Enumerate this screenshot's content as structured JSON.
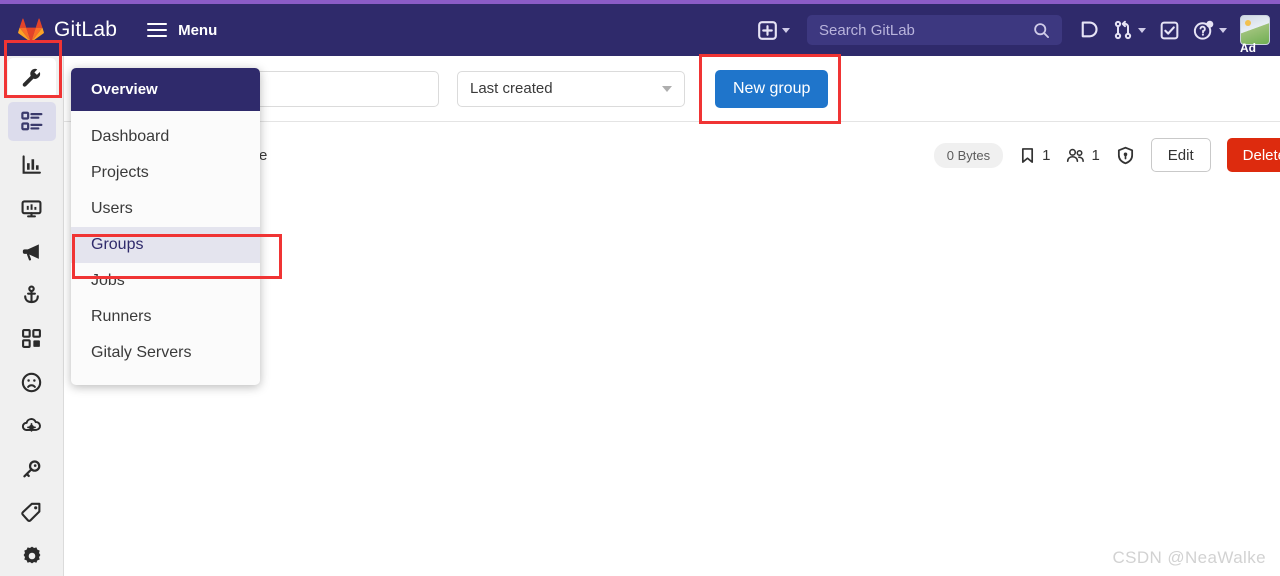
{
  "header": {
    "brand": "GitLab",
    "menu_label": "Menu",
    "logo_icon": "gitlab-tanuki-logo",
    "hamburger_icon": "hamburger-icon",
    "plus_icon": "plus-square-icon",
    "search": {
      "placeholder": "Search GitLab",
      "value": "",
      "icon": "search-icon"
    },
    "issues_icon": "issues-icon",
    "merge_requests_icon": "merge-request-icon",
    "todos_icon": "todo-check-icon",
    "help_icon": "help-question-icon",
    "avatar": {
      "name": "Ad",
      "icon": "user-avatar"
    }
  },
  "rail": {
    "items": [
      {
        "name": "admin-wrench",
        "icon": "wrench-icon",
        "state": "first"
      },
      {
        "name": "overview",
        "icon": "list-details-icon",
        "state": "active"
      },
      {
        "name": "analytics",
        "icon": "chart-bar-icon",
        "state": ""
      },
      {
        "name": "monitoring",
        "icon": "monitor-icon",
        "state": ""
      },
      {
        "name": "messages",
        "icon": "megaphone-icon",
        "state": ""
      },
      {
        "name": "deploy-keys",
        "icon": "anchor-icon",
        "state": ""
      },
      {
        "name": "applications",
        "icon": "apps-grid-icon",
        "state": ""
      },
      {
        "name": "abuse-reports",
        "icon": "sad-face-icon",
        "state": ""
      },
      {
        "name": "kubernetes",
        "icon": "cloud-gear-icon",
        "state": ""
      },
      {
        "name": "credentials",
        "icon": "key-icon",
        "state": ""
      },
      {
        "name": "labels",
        "icon": "tag-icon",
        "state": ""
      },
      {
        "name": "settings",
        "icon": "gear-icon",
        "state": ""
      }
    ]
  },
  "dropdown": {
    "title": "Overview",
    "items": [
      {
        "label": "Dashboard",
        "selected": false
      },
      {
        "label": "Projects",
        "selected": false
      },
      {
        "label": "Users",
        "selected": false
      },
      {
        "label": "Groups",
        "selected": true
      },
      {
        "label": "Jobs",
        "selected": false
      },
      {
        "label": "Runners",
        "selected": false
      },
      {
        "label": "Gitaly Servers",
        "selected": false
      }
    ]
  },
  "toolbar": {
    "filter": {
      "value": "",
      "placeholder": ""
    },
    "sort": {
      "value": "Last created",
      "caret_icon": "chevron-down-icon"
    },
    "new_group_label": "New group"
  },
  "row": {
    "name_fragment": "e",
    "size_badge": "0 Bytes",
    "projects": {
      "icon": "bookmark-icon",
      "count": "1"
    },
    "members": {
      "icon": "users-icon",
      "count": "1"
    },
    "security_icon": "shield-icon",
    "edit_label": "Edit",
    "delete_label": "Delete"
  },
  "watermark": "CSDN @NeaWalke",
  "colors": {
    "header_bg": "#2f2a6b",
    "top_accent": "#8b5cc7",
    "primary_button": "#1f75cb",
    "danger_button": "#dd2b0e",
    "highlight_box": "#f03434",
    "selected_item_bg": "#e4e4ee"
  }
}
